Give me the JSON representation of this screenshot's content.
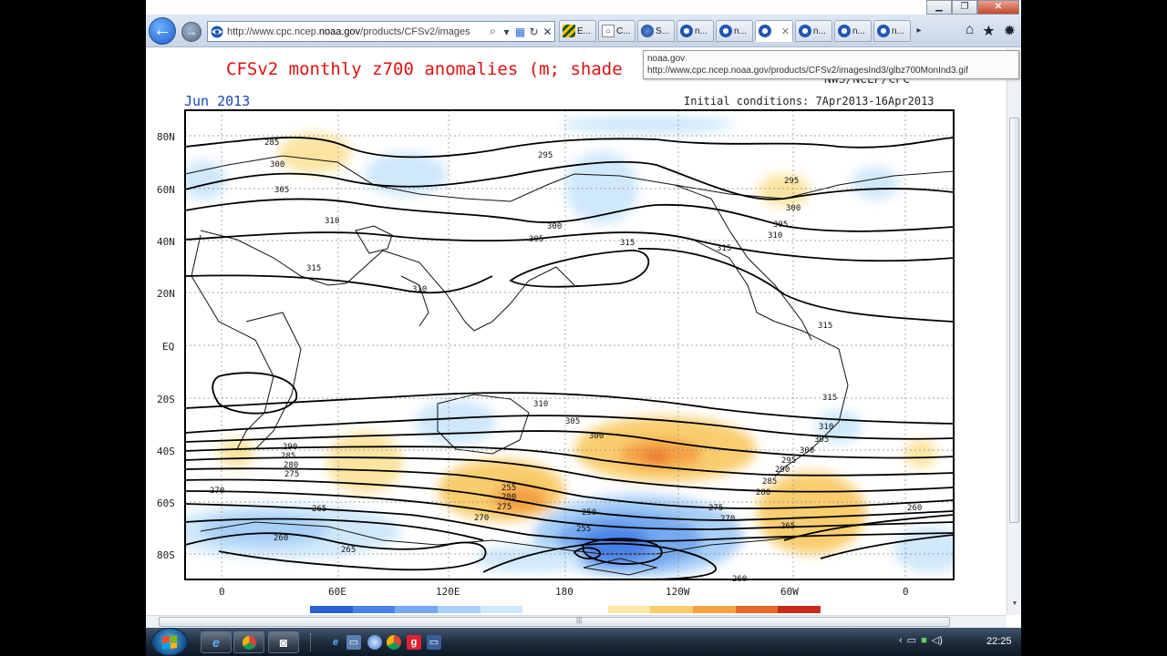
{
  "browser": {
    "address_url": "http://www.cpc.ncep.",
    "address_domain": "noaa.gov",
    "address_rest": "/products/CFSv2/images",
    "tabs": [
      "E...",
      "C...",
      "S...",
      "n...",
      "n...",
      "",
      "n...",
      "n...",
      "n..."
    ],
    "tooltip_title": "noaa.gov",
    "tooltip_url": "http://www.cpc.ncep.noaa.gov/products/CFSv2/imagesInd3/glbz700MonInd3.gif"
  },
  "map": {
    "title": "CFSv2 monthly z700 anomalies (m; shade",
    "credit": "NWS/NCEP/CPC",
    "month": "Jun 2013",
    "init": "Initial conditions: 7Apr2013-16Apr2013",
    "lat_labels": [
      "80N",
      "60N",
      "40N",
      "20N",
      "EQ",
      "20S",
      "40S",
      "60S",
      "80S"
    ],
    "lon_labels": [
      "0",
      "60E",
      "120E",
      "180",
      "120W",
      "60W",
      "0"
    ],
    "contour_labels": [
      "285",
      "300",
      "305",
      "295",
      "310",
      "315",
      "300",
      "305",
      "310",
      "315",
      "295",
      "300",
      "305",
      "315",
      "310",
      "315",
      "315",
      "310",
      "305",
      "300",
      "310",
      "305",
      "300",
      "295",
      "290",
      "285",
      "280",
      "275",
      "270",
      "265",
      "260",
      "255",
      "250",
      "290",
      "285",
      "280",
      "275",
      "270",
      "265",
      "260",
      "255",
      "280",
      "275",
      "270",
      "265",
      "260"
    ],
    "colorbar_colors": [
      "#2a5fd8",
      "#4a82e6",
      "#75a9f0",
      "#a8cff7",
      "#cfe8fa",
      "#ffffff",
      "#ffffff",
      "#fbe8a6",
      "#f9cd6e",
      "#f4a142",
      "#e86a2a",
      "#cc2a1a"
    ]
  },
  "taskbar": {
    "clock": "22:25"
  }
}
